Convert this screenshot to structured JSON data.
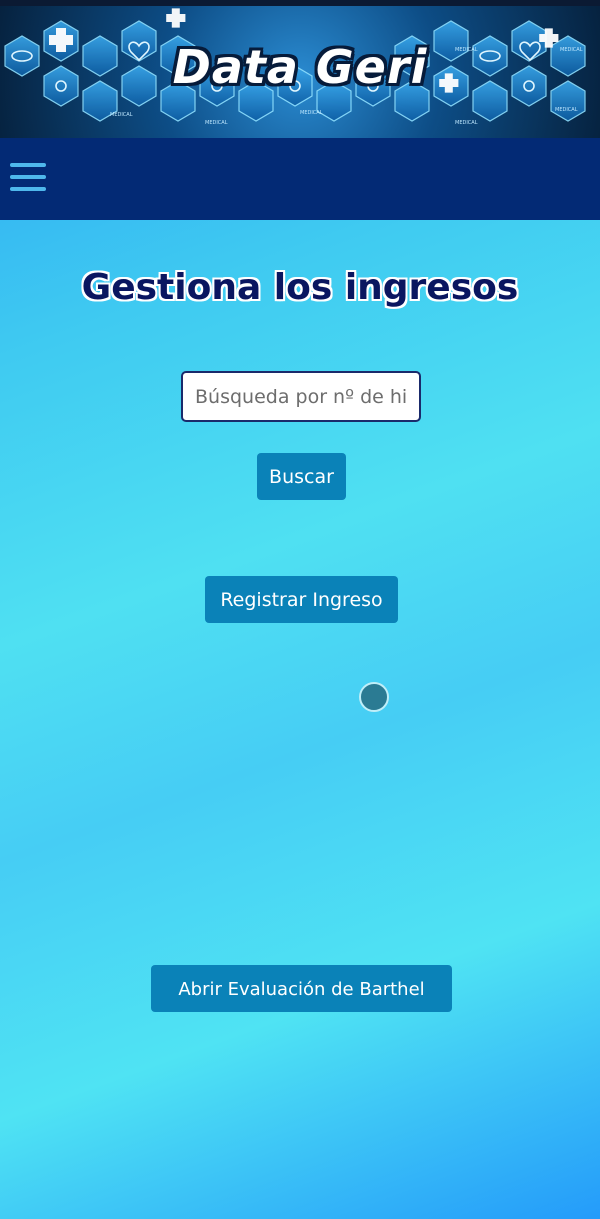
{
  "banner": {
    "title": "Data Geri",
    "decorations": [
      {
        "label": "MEDICAL"
      },
      {
        "label": "MEDICAL"
      },
      {
        "label": "MEDICAL"
      },
      {
        "label": "MEDICAL"
      },
      {
        "label": "MEDICAL"
      },
      {
        "label": "MEDICAL"
      },
      {
        "label": "MEDICAL"
      }
    ]
  },
  "navbar": {
    "menu_icon": "hamburger-menu-icon"
  },
  "main": {
    "title": "Gestiona los ingresos",
    "search": {
      "placeholder": "Búsqueda por nº de historia",
      "value": ""
    },
    "buttons": {
      "search_label": "Buscar",
      "register_label": "Registrar Ingreso",
      "barthel_label": "Abrir Evaluación de Barthel"
    }
  },
  "colors": {
    "navbar": "#032a75",
    "button": "#0a82b8",
    "title": "#0a1660",
    "hamburger": "#4fb8ec"
  }
}
